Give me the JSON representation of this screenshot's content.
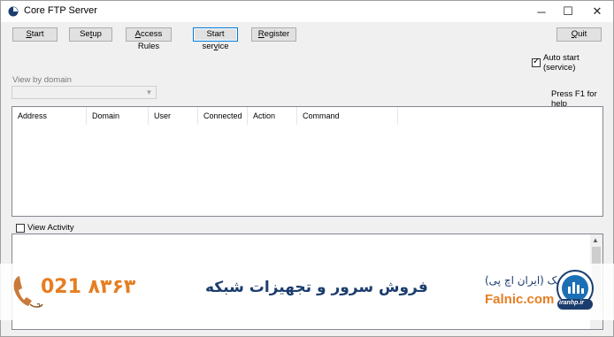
{
  "window": {
    "title": "Core FTP Server",
    "controls": {
      "minimize": "─",
      "maximize": "☐",
      "close": "✕"
    }
  },
  "toolbar": {
    "start": {
      "acc": "S",
      "rest": "tart"
    },
    "setup": {
      "pre": "Se",
      "acc": "t",
      "rest": "up"
    },
    "access_rules": {
      "pre": "",
      "acc": "A",
      "rest": "ccess Rules"
    },
    "start_service": {
      "pre": "Start ser",
      "acc": "v",
      "rest": "ice"
    },
    "register": {
      "acc": "R",
      "rest": "egister"
    },
    "quit": {
      "acc": "Q",
      "rest": "uit"
    }
  },
  "auto_start": {
    "label": "Auto start (service)",
    "checked": true
  },
  "view_by_domain": {
    "label": "View by domain",
    "value": ""
  },
  "help_hint": "Press F1 for help",
  "list": {
    "columns": [
      "Address",
      "Domain",
      "User",
      "Connected",
      "Action",
      "Command"
    ],
    "rows": []
  },
  "view_activity": {
    "label": "View Activity",
    "checked": false
  },
  "watermark": {
    "phone": "021 ۸۳۶۳",
    "tagline": "فروش سرور و تجهیزات شبکه",
    "brand_fa": "فالنیک (ایران اچ پی)",
    "brand_en": "Falnic.com",
    "logo_text": "iranhp.ir"
  },
  "colors": {
    "accent_orange": "#e67e22",
    "brand_navy": "#1b3d6e",
    "focus_blue": "#0078d7"
  }
}
